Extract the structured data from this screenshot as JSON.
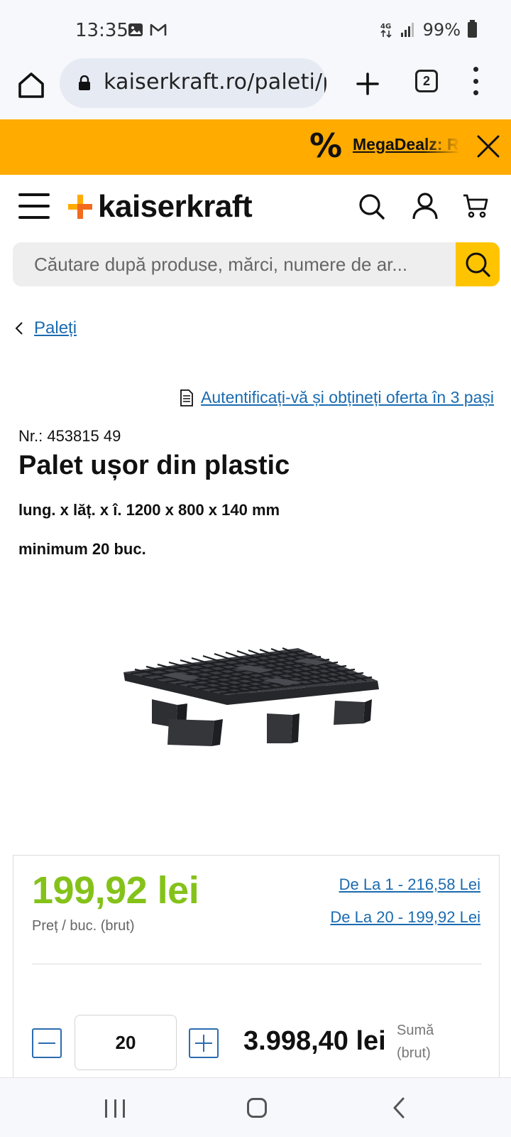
{
  "status_bar": {
    "time": "13:35",
    "network": "4G",
    "battery": "99%",
    "icons": [
      "gallery-icon",
      "gmail-icon",
      "network-4g-icon",
      "signal-icon",
      "battery-icon"
    ]
  },
  "browser": {
    "url": "kaiserkraft.ro/paleti/p",
    "tab_count": "2"
  },
  "promo": {
    "symbol": "%",
    "label": "MegaDealz: R",
    "background_color": "#ffab00"
  },
  "header": {
    "logo_text": "kaiserkraft",
    "logo_colors": [
      "#ffab00",
      "#f26b1d"
    ],
    "icons": [
      "menu-icon",
      "search-icon",
      "account-icon",
      "cart-icon"
    ]
  },
  "search": {
    "placeholder": "Căutare după produse, mărci, numere de ar..."
  },
  "breadcrumb": {
    "label": "Paleți"
  },
  "login_offer": {
    "label": "Autentificați-vă și obțineți oferta în 3 pași"
  },
  "product": {
    "nr": "Nr.: 453815 49",
    "title": "Palet ușor din plastic",
    "dimensions": "lung. x lăț. x î. 1200 x 800 x 140 mm",
    "minimum": "minimum 20 buc."
  },
  "pricing": {
    "price": "199,92 lei",
    "price_note": "Preț / buc. (brut)",
    "price_color": "#84c21a",
    "tiers": [
      "De La 1 - 216,58 Lei",
      "De La 20 - 199,92 Lei"
    ],
    "quantity": "20",
    "total": "3.998,40 lei",
    "total_note": "Sumă (brut)"
  }
}
